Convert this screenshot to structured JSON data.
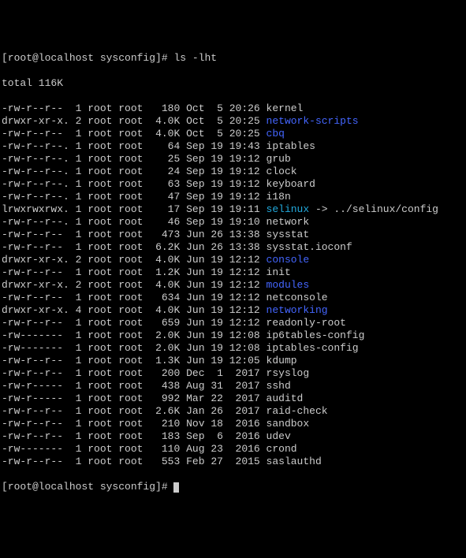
{
  "prompt1": "[root@localhost sysconfig]# ",
  "command": "ls -lht",
  "total": "total 116K",
  "prompt2": "[root@localhost sysconfig]# ",
  "files": [
    {
      "perm": "-rw-r--r--",
      "ln": "1",
      "own": "root root",
      "size": "  180",
      "date": "Oct  5 20:26",
      "name": "kernel",
      "cls": ""
    },
    {
      "perm": "drwxr-xr-x.",
      "ln": "2",
      "own": "root root",
      "size": " 4.0K",
      "date": "Oct  5 20:25",
      "name": "network-scripts",
      "cls": "blue"
    },
    {
      "perm": "-rw-r--r--",
      "ln": "1",
      "own": "root root",
      "size": " 4.0K",
      "date": "Oct  5 20:25",
      "name": "cbq",
      "cls": "blue"
    },
    {
      "perm": "-rw-r--r--.",
      "ln": "1",
      "own": "root root",
      "size": "   64",
      "date": "Sep 19 19:43",
      "name": "iptables",
      "cls": ""
    },
    {
      "perm": "-rw-r--r--.",
      "ln": "1",
      "own": "root root",
      "size": "   25",
      "date": "Sep 19 19:12",
      "name": "grub",
      "cls": ""
    },
    {
      "perm": "-rw-r--r--.",
      "ln": "1",
      "own": "root root",
      "size": "   24",
      "date": "Sep 19 19:12",
      "name": "clock",
      "cls": ""
    },
    {
      "perm": "-rw-r--r--.",
      "ln": "1",
      "own": "root root",
      "size": "   63",
      "date": "Sep 19 19:12",
      "name": "keyboard",
      "cls": ""
    },
    {
      "perm": "-rw-r--r--.",
      "ln": "1",
      "own": "root root",
      "size": "   47",
      "date": "Sep 19 19:12",
      "name": "i18n",
      "cls": ""
    },
    {
      "perm": "lrwxrwxrwx.",
      "ln": "1",
      "own": "root root",
      "size": "   17",
      "date": "Sep 19 19:11",
      "name": "selinux",
      "cls": "cyan",
      "link": " -> ../selinux/config"
    },
    {
      "perm": "-rw-r--r--.",
      "ln": "1",
      "own": "root root",
      "size": "   46",
      "date": "Sep 19 19:10",
      "name": "network",
      "cls": ""
    },
    {
      "perm": "-rw-r--r--",
      "ln": "1",
      "own": "root root",
      "size": "  473",
      "date": "Jun 26 13:38",
      "name": "sysstat",
      "cls": ""
    },
    {
      "perm": "-rw-r--r--",
      "ln": "1",
      "own": "root root",
      "size": " 6.2K",
      "date": "Jun 26 13:38",
      "name": "sysstat.ioconf",
      "cls": ""
    },
    {
      "perm": "drwxr-xr-x.",
      "ln": "2",
      "own": "root root",
      "size": " 4.0K",
      "date": "Jun 19 12:12",
      "name": "console",
      "cls": "blue"
    },
    {
      "perm": "-rw-r--r--",
      "ln": "1",
      "own": "root root",
      "size": " 1.2K",
      "date": "Jun 19 12:12",
      "name": "init",
      "cls": ""
    },
    {
      "perm": "drwxr-xr-x.",
      "ln": "2",
      "own": "root root",
      "size": " 4.0K",
      "date": "Jun 19 12:12",
      "name": "modules",
      "cls": "blue"
    },
    {
      "perm": "-rw-r--r--",
      "ln": "1",
      "own": "root root",
      "size": "  634",
      "date": "Jun 19 12:12",
      "name": "netconsole",
      "cls": ""
    },
    {
      "perm": "drwxr-xr-x.",
      "ln": "4",
      "own": "root root",
      "size": " 4.0K",
      "date": "Jun 19 12:12",
      "name": "networking",
      "cls": "blue"
    },
    {
      "perm": "-rw-r--r--",
      "ln": "1",
      "own": "root root",
      "size": "  659",
      "date": "Jun 19 12:12",
      "name": "readonly-root",
      "cls": ""
    },
    {
      "perm": "-rw-------",
      "ln": "1",
      "own": "root root",
      "size": " 2.0K",
      "date": "Jun 19 12:08",
      "name": "ip6tables-config",
      "cls": ""
    },
    {
      "perm": "-rw-------",
      "ln": "1",
      "own": "root root",
      "size": " 2.0K",
      "date": "Jun 19 12:08",
      "name": "iptables-config",
      "cls": ""
    },
    {
      "perm": "-rw-r--r--",
      "ln": "1",
      "own": "root root",
      "size": " 1.3K",
      "date": "Jun 19 12:05",
      "name": "kdump",
      "cls": ""
    },
    {
      "perm": "-rw-r--r--",
      "ln": "1",
      "own": "root root",
      "size": "  200",
      "date": "Dec  1  2017",
      "name": "rsyslog",
      "cls": ""
    },
    {
      "perm": "-rw-r-----",
      "ln": "1",
      "own": "root root",
      "size": "  438",
      "date": "Aug 31  2017",
      "name": "sshd",
      "cls": ""
    },
    {
      "perm": "-rw-r-----",
      "ln": "1",
      "own": "root root",
      "size": "  992",
      "date": "Mar 22  2017",
      "name": "auditd",
      "cls": ""
    },
    {
      "perm": "-rw-r--r--",
      "ln": "1",
      "own": "root root",
      "size": " 2.6K",
      "date": "Jan 26  2017",
      "name": "raid-check",
      "cls": ""
    },
    {
      "perm": "-rw-r--r--",
      "ln": "1",
      "own": "root root",
      "size": "  210",
      "date": "Nov 18  2016",
      "name": "sandbox",
      "cls": ""
    },
    {
      "perm": "-rw-r--r--",
      "ln": "1",
      "own": "root root",
      "size": "  183",
      "date": "Sep  6  2016",
      "name": "udev",
      "cls": ""
    },
    {
      "perm": "-rw-------",
      "ln": "1",
      "own": "root root",
      "size": "  110",
      "date": "Aug 23  2016",
      "name": "crond",
      "cls": ""
    },
    {
      "perm": "-rw-r--r--",
      "ln": "1",
      "own": "root root",
      "size": "  553",
      "date": "Feb 27  2015",
      "name": "saslauthd",
      "cls": ""
    }
  ]
}
